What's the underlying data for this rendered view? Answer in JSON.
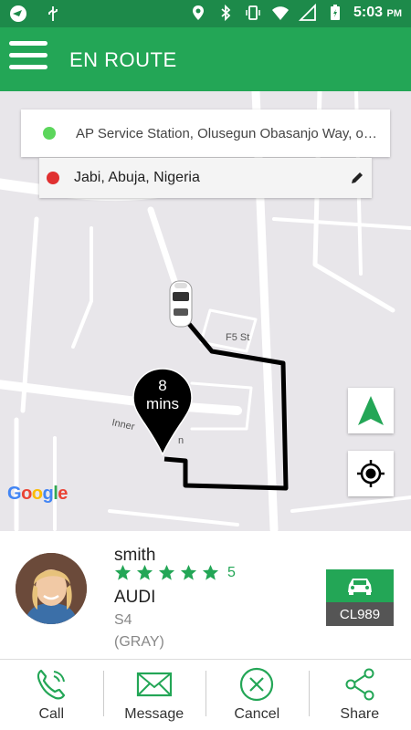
{
  "status_bar": {
    "time": "5:03",
    "ampm": "PM",
    "icons": [
      "app-icon",
      "usb-icon",
      "location-icon",
      "bluetooth-icon",
      "vibrate-icon",
      "wifi-icon",
      "signal-icon",
      "battery-icon"
    ]
  },
  "app_bar": {
    "title": "EN ROUTE",
    "menu_icon": "hamburger-menu-icon"
  },
  "trip": {
    "pickup": "AP Service Station, Olusegun Obasanjo Way, off Obafemi Awolowo Way",
    "dropoff": "Jabi, Abuja, Nigeria",
    "eta_value": "8",
    "eta_unit": "mins"
  },
  "map": {
    "street_labels": [
      "F5 St",
      "Inner",
      "n"
    ],
    "google_letters": [
      "G",
      "o",
      "o",
      "g",
      "l",
      "e"
    ],
    "route_color": "#000000"
  },
  "driver": {
    "name": "smith",
    "rating": 5,
    "rating_label": "5",
    "car_make": "AUDI",
    "car_model": "S4",
    "car_color": "(GRAY)",
    "plate": "CL989"
  },
  "actions": [
    {
      "label": "Call",
      "icon": "phone-icon"
    },
    {
      "label": "Message",
      "icon": "envelope-icon"
    },
    {
      "label": "Cancel",
      "icon": "cancel-circle-icon"
    },
    {
      "label": "Share",
      "icon": "share-icon"
    }
  ],
  "colors": {
    "primary": "#23a656",
    "status_bar": "#1d8a4a",
    "pickup_dot": "#5cd65c",
    "dropoff_dot": "#e03030"
  }
}
